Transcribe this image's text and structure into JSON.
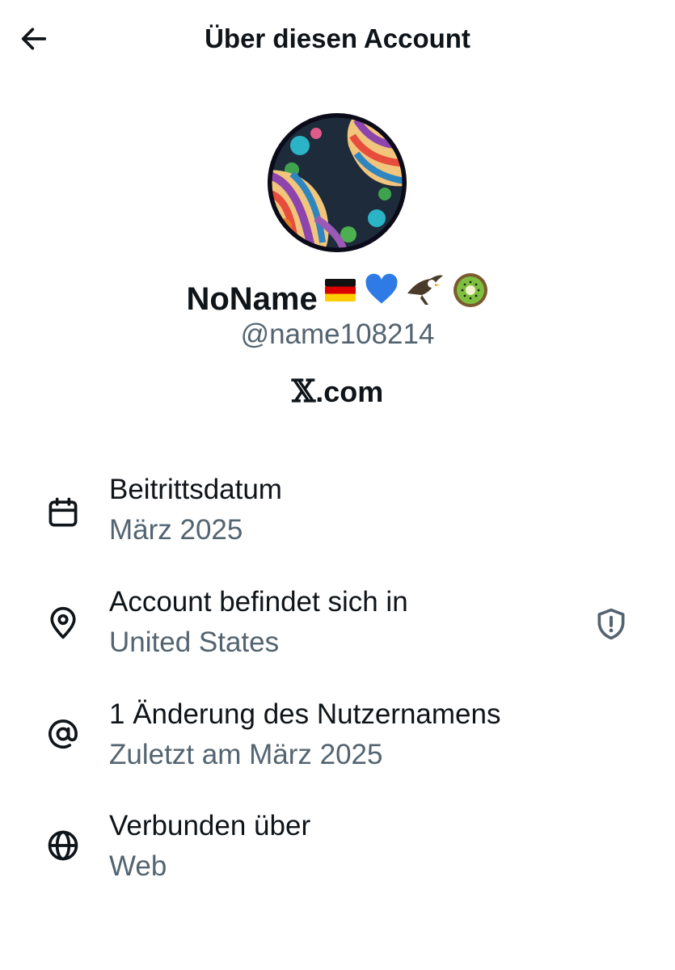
{
  "header": {
    "title": "Über diesen Account",
    "back_icon": "arrow-left-icon"
  },
  "profile": {
    "display_name": "NoName",
    "name_emojis": [
      "german-flag",
      "blue-heart",
      "eagle",
      "kiwi-fruit"
    ],
    "handle": "@name108214",
    "source_mark": "𝕏",
    "source_text": ".com"
  },
  "details": [
    {
      "icon": "calendar-icon",
      "label": "Beitrittsdatum",
      "value": "März 2025"
    },
    {
      "icon": "location-pin-icon",
      "label": "Account befindet sich in",
      "value": "United States",
      "trailing_icon": "shield-alert-icon"
    },
    {
      "icon": "at-sign-icon",
      "label": "1 Änderung des Nutzernamens",
      "value": "Zuletzt am März 2025"
    },
    {
      "icon": "globe-icon",
      "label": "Verbunden über",
      "value": "Web"
    }
  ],
  "colors": {
    "text_primary": "#0f1419",
    "text_secondary": "#536471"
  }
}
